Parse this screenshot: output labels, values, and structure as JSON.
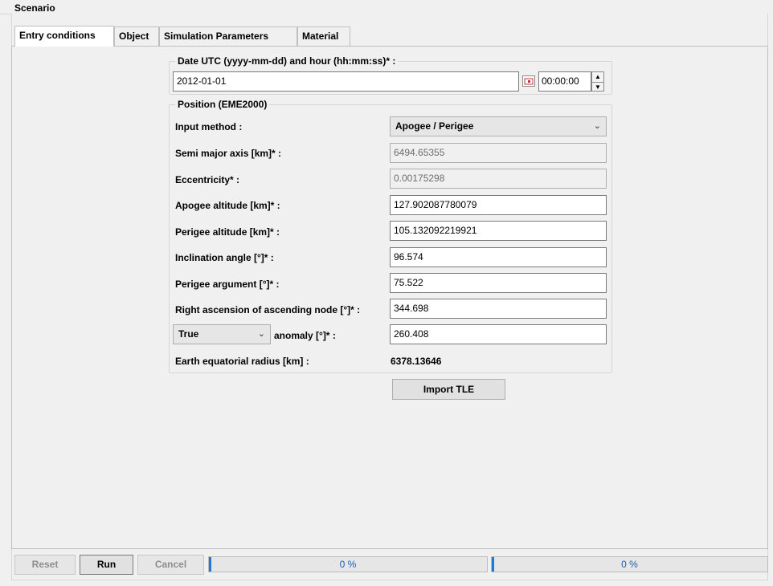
{
  "scenario": {
    "title": "Scenario"
  },
  "tabs": [
    {
      "label": "Entry conditions",
      "active": true
    },
    {
      "label": "Object",
      "active": false
    },
    {
      "label": "Simulation Parameters",
      "active": false
    },
    {
      "label": "Material",
      "active": false
    }
  ],
  "date_group": {
    "title": "Date UTC (yyyy-mm-dd) and hour (hh:mm:ss)* :",
    "date_value": "2012-01-01",
    "time_value": "00:00:00",
    "calendar_icon": "calendar-icon"
  },
  "position_group": {
    "title": "Position (EME2000)",
    "input_method_label": "Input method :",
    "input_method_value": "Apogee / Perigee",
    "fields": [
      {
        "label": "Semi major axis [km]* :",
        "value": "6494.65355",
        "disabled": true
      },
      {
        "label": "Eccentricity* :",
        "value": "0.00175298",
        "disabled": true
      },
      {
        "label": "Apogee altitude [km]* :",
        "value": "127.902087780079",
        "disabled": false
      },
      {
        "label": "Perigee altitude [km]* :",
        "value": "105.132092219921",
        "disabled": false
      },
      {
        "label": "Inclination angle [°]* :",
        "value": "96.574",
        "disabled": false
      },
      {
        "label": "Perigee argument [°]* :",
        "value": "75.522",
        "disabled": false
      },
      {
        "label": "Right ascension of ascending node [°]* :",
        "value": "344.698",
        "disabled": false
      }
    ],
    "anomaly_type": "True",
    "anomaly_label": "anomaly [°]* :",
    "anomaly_value": "260.408",
    "earth_radius_label": "Earth equatorial radius [km] :",
    "earth_radius_value": "6378.13646"
  },
  "import_tle_label": "Import TLE",
  "bottom": {
    "reset_label": "Reset",
    "run_label": "Run",
    "cancel_label": "Cancel",
    "progress1": {
      "text": "0 %",
      "value": 0
    },
    "progress2": {
      "text": "0 %",
      "value": 0
    }
  },
  "colors": {
    "progress": "#1e7ad6",
    "panel": "#f0f0f0"
  }
}
